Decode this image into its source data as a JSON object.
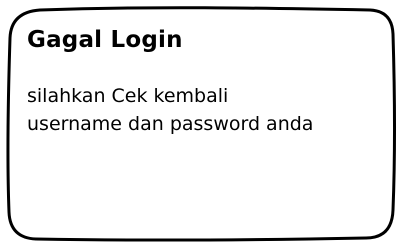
{
  "dialog": {
    "title": "Gagal Login",
    "message_lines": [
      "silahkan Cek kembali",
      "username dan password anda"
    ],
    "border_color": "#000000",
    "background": "#ffffff"
  }
}
